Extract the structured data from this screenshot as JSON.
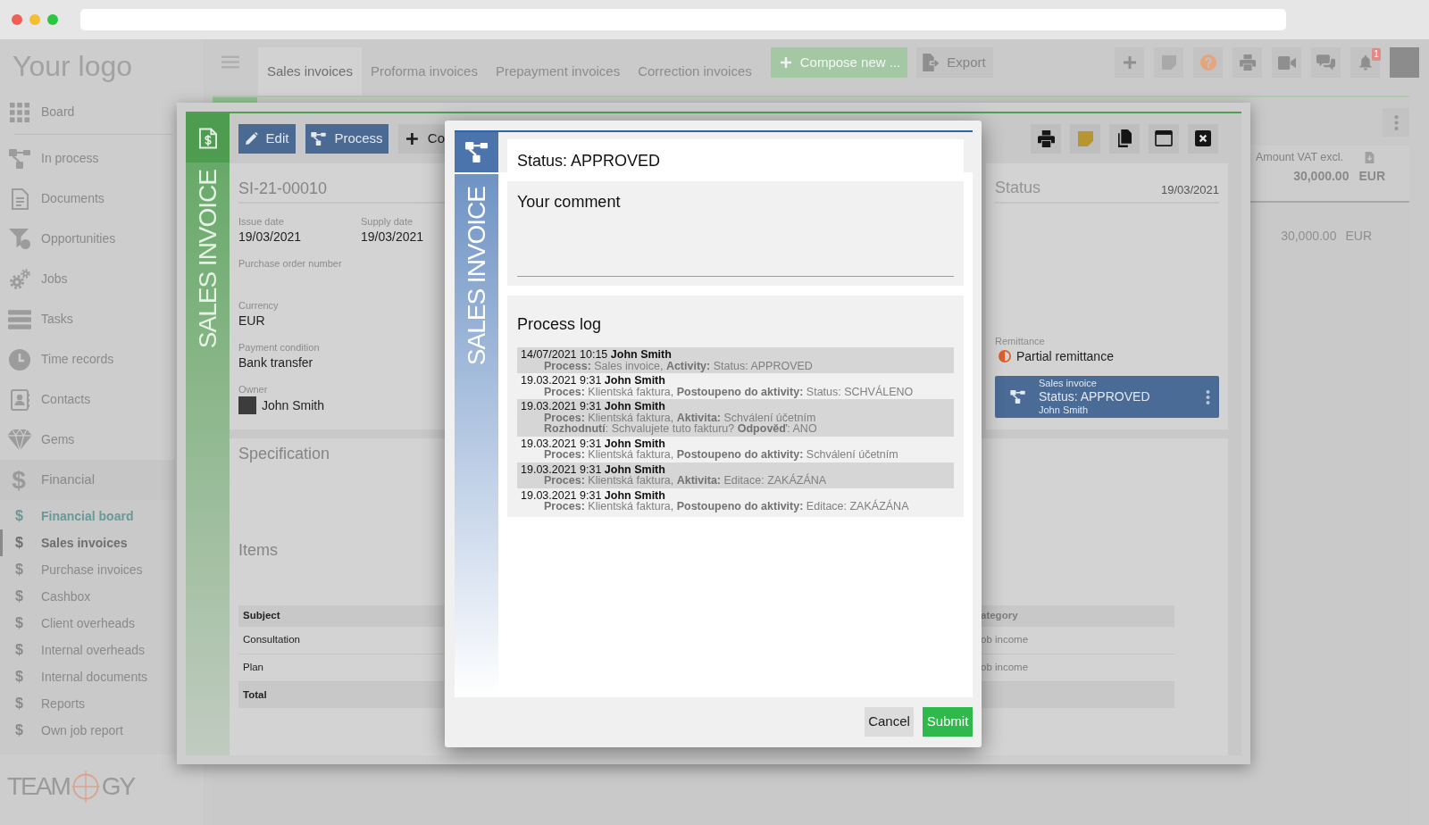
{
  "sidebar": {
    "logo": "Your logo",
    "items": [
      {
        "label": "Board"
      },
      {
        "label": "In process"
      },
      {
        "label": "Documents"
      },
      {
        "label": "Opportunities"
      },
      {
        "label": "Jobs"
      },
      {
        "label": "Tasks"
      },
      {
        "label": "Time records"
      },
      {
        "label": "Contacts"
      },
      {
        "label": "Gems"
      }
    ],
    "section": {
      "icon": "$",
      "label": "Financial",
      "children": [
        {
          "icon": "$",
          "label": "Financial board",
          "kind": "board",
          "selected": false
        },
        {
          "icon": "$",
          "label": "Sales invoices",
          "kind": "page",
          "selected": true
        },
        {
          "icon": "$",
          "label": "Purchase invoices",
          "kind": "page",
          "selected": false
        },
        {
          "icon": "$",
          "label": "Cashbox",
          "kind": "page",
          "selected": false
        },
        {
          "icon": "$",
          "label": "Client overheads",
          "kind": "page",
          "selected": false
        },
        {
          "icon": "$",
          "label": "Internal overheads",
          "kind": "page",
          "selected": false
        },
        {
          "icon": "$",
          "label": "Internal documents",
          "kind": "page",
          "selected": false
        },
        {
          "icon": "$",
          "label": "Reports",
          "kind": "page",
          "selected": false
        },
        {
          "icon": "$",
          "label": "Own job report",
          "kind": "page",
          "selected": false
        }
      ]
    },
    "footer_logo": {
      "left": "TEAM",
      "right": "GY"
    }
  },
  "top_bar": {
    "tabs": [
      {
        "label": "Sales invoices",
        "selected": true
      },
      {
        "label": "Proforma invoices",
        "selected": false
      },
      {
        "label": "Prepayment invoices",
        "selected": false
      },
      {
        "label": "Correction invoices",
        "selected": false
      }
    ],
    "actions": [
      {
        "label": "Compose new ...",
        "kind": "compose"
      },
      {
        "label": "Export",
        "kind": "export"
      }
    ],
    "notification_badge": "1"
  },
  "summary": {
    "column_label": "Amount VAT excl.",
    "total_amount": "30,000.00",
    "total_currency": "EUR",
    "row_amount": "30,000.00",
    "row_currency": "EUR"
  },
  "invoice_window": {
    "side_label": "SALES INVOICE",
    "actions": [
      {
        "label": "Edit",
        "kind": "edit"
      },
      {
        "label": "Process",
        "kind": "process"
      },
      {
        "label": "Co",
        "kind": "add"
      }
    ],
    "number": "SI-21-00010",
    "field_rows": [
      [
        {
          "label": "Issue date",
          "value": "19/03/2021",
          "kind": "text"
        },
        {
          "label": "Supply date",
          "value": "19/03/2021",
          "kind": "text"
        }
      ],
      [
        {
          "label": "Purchase order number",
          "kind": "text"
        }
      ],
      [
        {
          "label": "Currency",
          "value": "EUR",
          "kind": "text"
        }
      ],
      [
        {
          "label": "Payment condition",
          "value": "Bank transfer",
          "kind": "text"
        }
      ],
      [
        {
          "label": "Owner",
          "value": "John Smith",
          "kind": "person"
        }
      ]
    ],
    "status": {
      "title": "Status",
      "date": "19/03/2021",
      "remittance_label": "Remittance",
      "remittance": "Partial remittance",
      "process_card": {
        "caption": "Sales invoice",
        "status": "Status: APPROVED",
        "user": "John Smith"
      }
    },
    "specification_title": "Specification",
    "items_title": "Items",
    "items_table": {
      "columns": [
        "Subject",
        "ategory"
      ],
      "rows": [
        [
          "Consultation",
          "ob income"
        ],
        [
          "Plan",
          "ob income"
        ]
      ],
      "total_label": "Total"
    }
  },
  "process_dialog": {
    "side_label": "SALES INVOICE",
    "status": "Status: APPROVED",
    "comment": {
      "label": "Your comment"
    },
    "log_title": "Process log",
    "log": [
      {
        "heading": "14/07/2021 10:15 **John Smith**",
        "details": [
          "**Process:** Sales invoice, **Activity:** Status: APPROVED"
        ]
      },
      {
        "heading": "19.03.2021 9:31 **John Smith**",
        "details": [
          "**Proces:** Klientská faktura, **Postoupeno do aktivity:** Status: SCHVÁLENO"
        ]
      },
      {
        "heading": "19.03.2021 9:31 **John Smith**",
        "details": [
          "**Proces:** Klientská faktura, **Aktivita:** Schválení účetním",
          "**Rozhodnutí**: Schvalujete tuto fakturu? **Odpověď**: ANO"
        ]
      },
      {
        "heading": "19.03.2021 9:31 **John Smith**",
        "details": [
          "**Proces:** Klientská faktura, **Postoupeno do aktivity:** Schválení účetním"
        ]
      },
      {
        "heading": "19.03.2021 9:31 **John Smith**",
        "details": [
          "**Proces:** Klientská faktura, **Aktivita:** Editace: ZAKÁZÁNA"
        ]
      },
      {
        "heading": "19.03.2021 9:31 **John Smith**",
        "details": [
          "**Proces:** Klientská faktura, **Postoupeno do aktivity:** Editace: ZAKÁZÁNA"
        ]
      }
    ],
    "buttons": [
      {
        "label": "Cancel",
        "kind": "cancel"
      },
      {
        "label": "Submit",
        "kind": "submit"
      }
    ]
  }
}
